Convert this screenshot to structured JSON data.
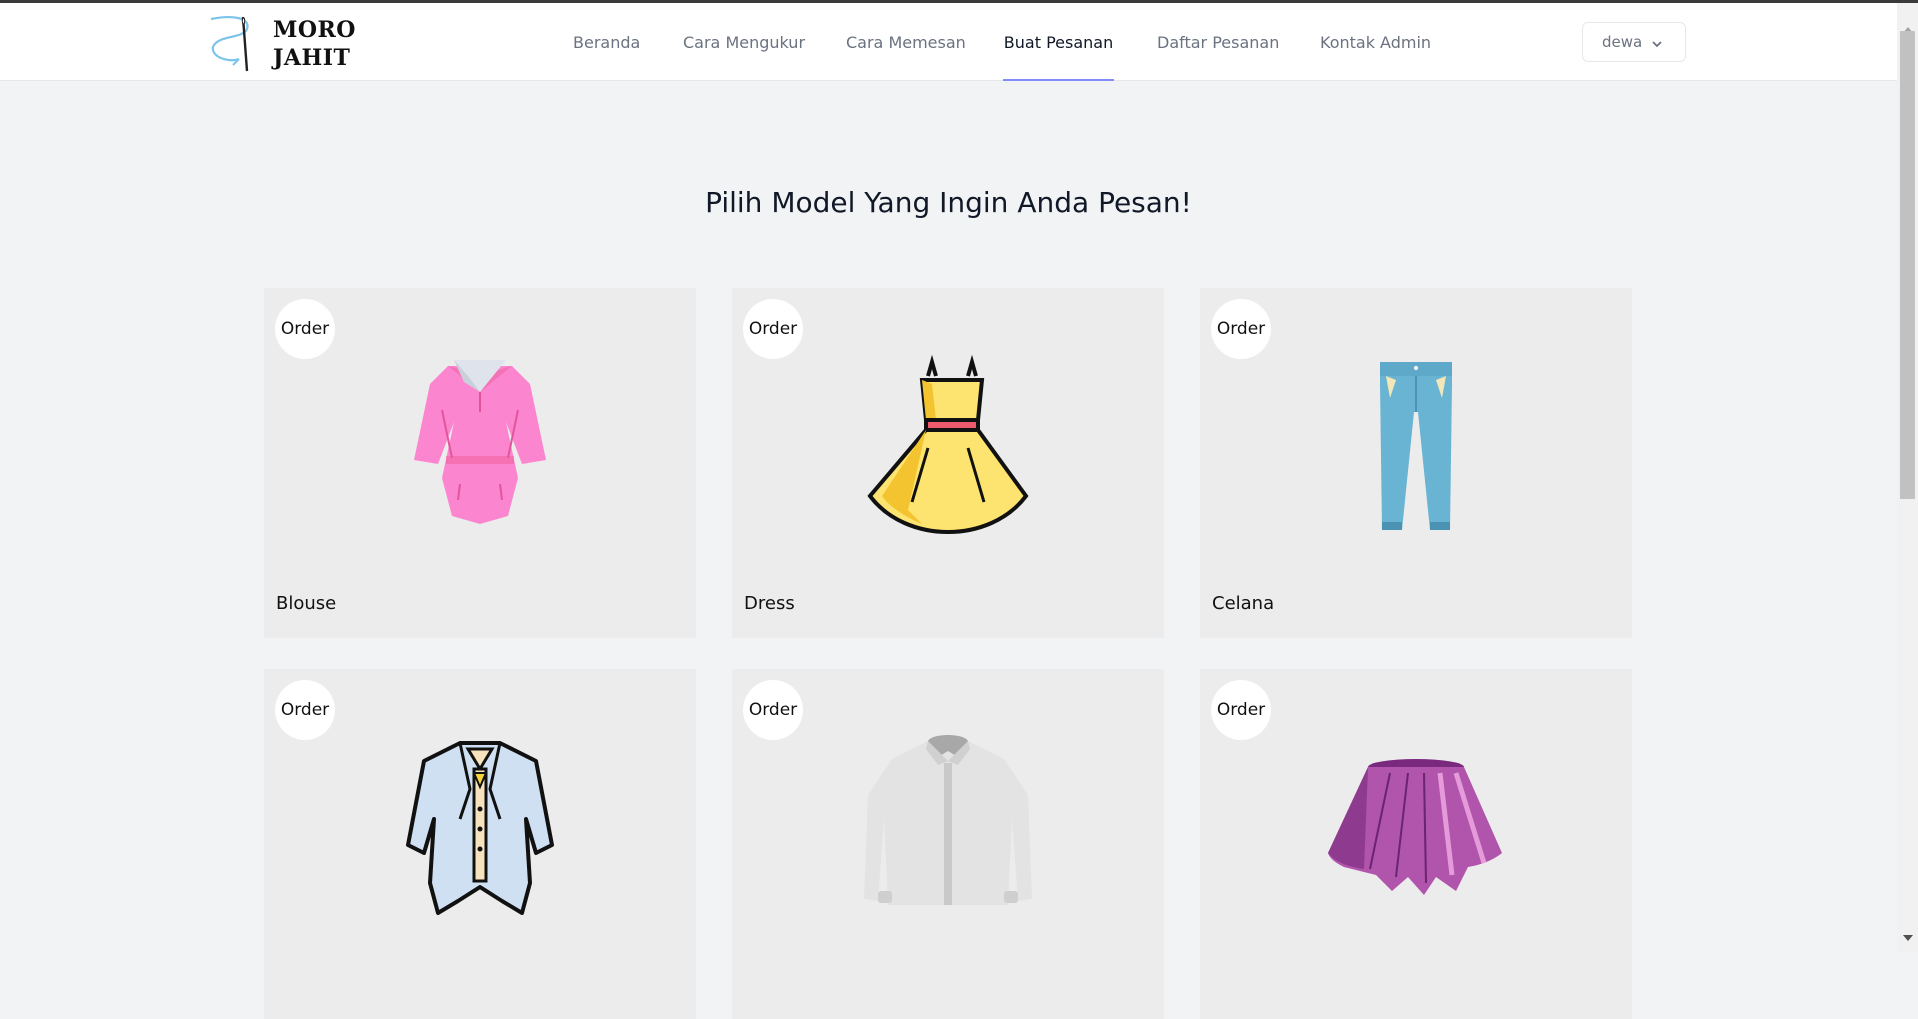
{
  "brand": {
    "line1": "MORO",
    "line2": "JAHIT"
  },
  "nav": {
    "items": [
      {
        "label": "Beranda",
        "active": false
      },
      {
        "label": "Cara Mengukur",
        "active": false
      },
      {
        "label": "Cara Memesan",
        "active": false
      },
      {
        "label": "Buat Pesanan",
        "active": true
      },
      {
        "label": "Daftar Pesanan",
        "active": false
      },
      {
        "label": "Kontak Admin",
        "active": false
      }
    ],
    "user": "dewa"
  },
  "main": {
    "headline": "Pilih Model Yang Ingin Anda Pesan!",
    "cards": [
      {
        "badge": "Order",
        "label": "Blouse",
        "icon": "blouse-icon"
      },
      {
        "badge": "Order",
        "label": "Dress",
        "icon": "dress-icon"
      },
      {
        "badge": "Order",
        "label": "Celana",
        "icon": "pants-icon"
      },
      {
        "badge": "Order",
        "label": "",
        "icon": "coat-icon"
      },
      {
        "badge": "Order",
        "label": "",
        "icon": "shirt-icon"
      },
      {
        "badge": "Order",
        "label": "",
        "icon": "skirt-icon"
      }
    ]
  },
  "colors": {
    "accent": "#818cf8",
    "page_bg": "#f2f3f5",
    "card_bg": "#ececec"
  }
}
